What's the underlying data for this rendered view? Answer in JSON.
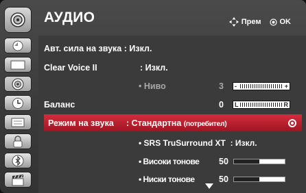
{
  "header": {
    "title": "АУДИО",
    "hint_move": "Прем",
    "hint_ok": "OK"
  },
  "sidebar": {
    "items": [
      {
        "name": "picture-icon"
      },
      {
        "name": "screen-icon"
      },
      {
        "name": "audio-icon",
        "active": true
      },
      {
        "name": "time-icon"
      },
      {
        "name": "options-icon"
      },
      {
        "name": "lock-icon"
      },
      {
        "name": "bluetooth-icon"
      },
      {
        "name": "clapperboard-icon"
      }
    ]
  },
  "menu": {
    "auto_volume": {
      "label": "Авт. сила на звука",
      "sep": ":",
      "value": "Изкл."
    },
    "clear_voice": {
      "label": "Clear Voice II",
      "sep": ":",
      "value": "Изкл."
    },
    "level": {
      "bullet": "•",
      "label": "Ниво",
      "value": "3",
      "minus": "-",
      "plus": "+",
      "fraction": 0.3
    },
    "balance": {
      "label": "Баланс",
      "value": "0",
      "left": "L",
      "right": "R",
      "fraction": 0.5
    },
    "sound_mode": {
      "label": "Режим на звука",
      "sep": ":",
      "value": "Стандартна",
      "value_suffix": "(потребител)"
    },
    "srs": {
      "bullet": "•",
      "label": "SRS TruSurround XT",
      "sep": ":",
      "value": "Изкл."
    },
    "treble": {
      "bullet": "•",
      "label": "Високи тонове",
      "value": "50",
      "fraction": 0.5
    },
    "bass": {
      "bullet": "•",
      "label": "Ниски тонове",
      "value": "50",
      "fraction": 0.5
    }
  }
}
